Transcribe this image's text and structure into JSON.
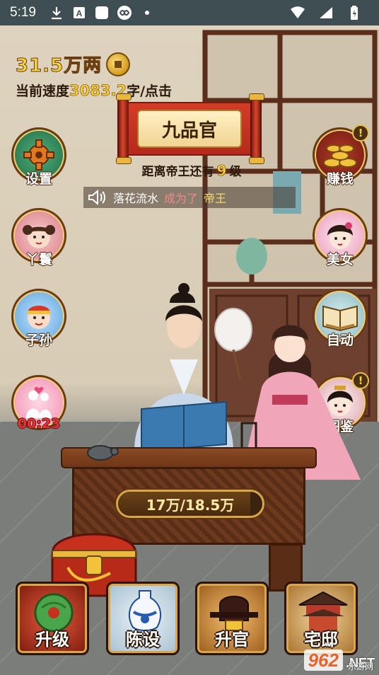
{
  "status_bar": {
    "time": "5:19"
  },
  "money": {
    "value": "31.5万两"
  },
  "speed": {
    "label": "当前速度",
    "value": "3083.2",
    "unit": "字/点击"
  },
  "rank": {
    "title": "九品官",
    "distance_prefix": "距离帝王还有",
    "distance_num": "9",
    "distance_suffix": "级"
  },
  "announcement": {
    "name": "落花流水",
    "verb": "成为了",
    "rank": "帝王"
  },
  "left_buttons": {
    "settings": "设置",
    "maid": "丫鬟",
    "descendants": "子孙",
    "timer": "00:23"
  },
  "right_buttons": {
    "earn": "赚钱",
    "beauty": "美女",
    "auto": "自动",
    "catalog": "图鉴",
    "alert": "!"
  },
  "progress": {
    "text": "17万/18.5万",
    "fraction": 0.919
  },
  "bottom_buttons": {
    "upgrade": "升级",
    "furnish": "陈设",
    "promote": "升官",
    "mansion": "宅邸"
  },
  "watermark": {
    "brand": "962",
    "net": ".NET",
    "sub": "乐游网"
  }
}
